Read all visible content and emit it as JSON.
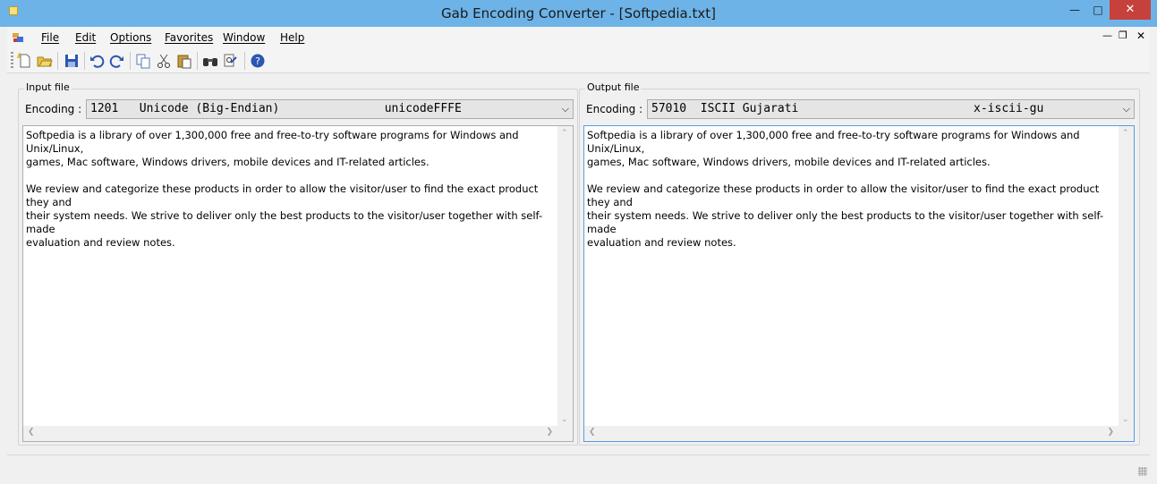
{
  "window": {
    "title": "Gab Encoding Converter - [Softpedia.txt]"
  },
  "menu": {
    "items": [
      "File",
      "Edit",
      "Options",
      "Favorites",
      "Window",
      "Help"
    ]
  },
  "toolbar": {
    "buttons": [
      "new-file-icon",
      "open-folder-icon",
      "save-icon",
      "undo-icon",
      "redo-icon",
      "copy-icon",
      "cut-icon",
      "paste-icon",
      "find-icon",
      "replace-icon",
      "help-icon"
    ]
  },
  "input": {
    "group_label": "Input file",
    "encoding_label": "Encoding :",
    "encoding_value": "1201   Unicode (Big-Endian)               unicodeFFFE",
    "text": "Softpedia is a library of over 1,300,000 free and free-to-try software programs for Windows and Unix/Linux,\ngames, Mac software, Windows drivers, mobile devices and IT-related articles.\n\nWe review and categorize these products in order to allow the visitor/user to find the exact product they and\ntheir system needs. We strive to deliver only the best products to the visitor/user together with self-made\nevaluation and review notes."
  },
  "output": {
    "group_label": "Output file",
    "encoding_label": "Encoding :",
    "encoding_value": "57010  ISCII Gujarati                         x-iscii-gu",
    "text": "Softpedia is a library of over 1,300,000 free and free-to-try software programs for Windows and Unix/Linux,\ngames, Mac software, Windows drivers, mobile devices and IT-related articles.\n\nWe review and categorize these products in order to allow the visitor/user to find the exact product they and\ntheir system needs. We strive to deliver only the best products to the visitor/user together with self-made\nevaluation and review notes."
  }
}
